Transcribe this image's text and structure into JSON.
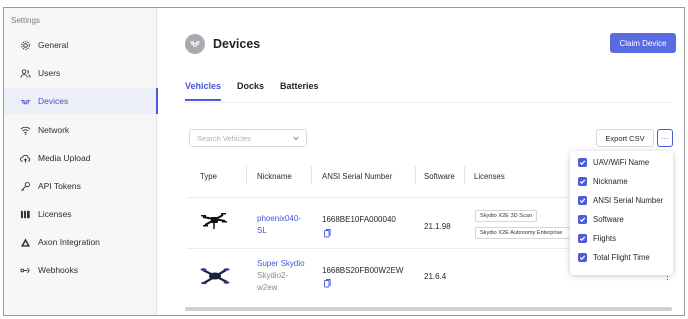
{
  "sidebar": {
    "title": "Settings",
    "items": [
      {
        "label": "General",
        "icon": "gear-icon",
        "active": false
      },
      {
        "label": "Users",
        "icon": "users-icon",
        "active": false
      },
      {
        "label": "Devices",
        "icon": "drone-icon",
        "active": true
      },
      {
        "label": "Network",
        "icon": "wifi-icon",
        "active": false
      },
      {
        "label": "Media Upload",
        "icon": "cloud-upload-icon",
        "active": false
      },
      {
        "label": "API Tokens",
        "icon": "key-icon",
        "active": false
      },
      {
        "label": "Licenses",
        "icon": "license-icon",
        "active": false
      },
      {
        "label": "Axon Integration",
        "icon": "axon-icon",
        "active": false
      },
      {
        "label": "Webhooks",
        "icon": "webhook-icon",
        "active": false
      }
    ]
  },
  "header": {
    "title": "Devices",
    "claim_button": "Claim Device"
  },
  "tabs": [
    {
      "label": "Vehicles",
      "active": true
    },
    {
      "label": "Docks",
      "active": false
    },
    {
      "label": "Batteries",
      "active": false
    }
  ],
  "toolbar": {
    "search_placeholder": "Search Vehicles",
    "export_button": "Export CSV",
    "more_label": "···"
  },
  "table": {
    "columns": [
      "Type",
      "Nickname",
      "ANSI Serial Number",
      "Software",
      "Licenses"
    ],
    "rows": [
      {
        "nickname_line1": "phoenix040-",
        "nickname_line2": "SL",
        "serial": "1668BE10FA000040",
        "software": "21.1.98",
        "licenses": [
          "Skydio X2E 3D Scan",
          "Skydio X2E Autonomy Enterprise"
        ]
      },
      {
        "nickname_line1": "Super Skydio",
        "nickname_sub1": "Skydio2-",
        "nickname_sub2": "w2ew",
        "serial": "1668BS20FB00W2EW",
        "software": "21.6.4",
        "row_menu": "⋮"
      }
    ]
  },
  "column_menu": {
    "items": [
      {
        "label": "UAV/WiFi Name",
        "checked": true
      },
      {
        "label": "Nickname",
        "checked": true
      },
      {
        "label": "ANSI Serial Number",
        "checked": true
      },
      {
        "label": "Software",
        "checked": true
      },
      {
        "label": "Flights",
        "checked": true
      },
      {
        "label": "Total Flight Time",
        "checked": true
      }
    ]
  },
  "colors": {
    "accent": "#4b5bdb",
    "primary_button": "#5a6ae0",
    "sidebar_bg": "#f7f7f7"
  }
}
